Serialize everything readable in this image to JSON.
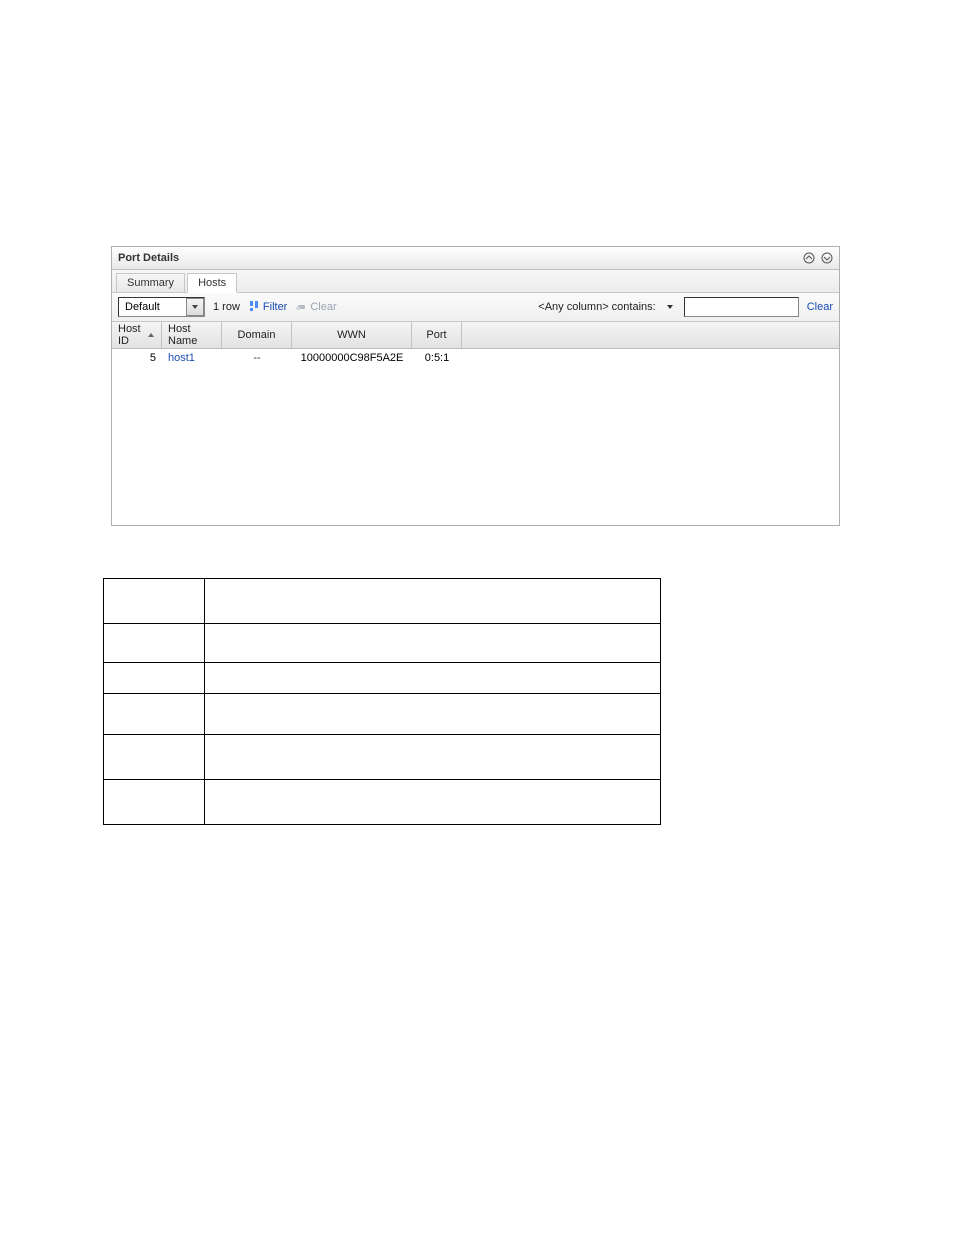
{
  "panel": {
    "title": "Port Details"
  },
  "tabs": {
    "summary": "Summary",
    "hosts": "Hosts",
    "active": "hosts"
  },
  "toolbar": {
    "view_selected": "Default",
    "row_count": "1 row",
    "filter_label": "Filter",
    "clear_filter_label": "Clear",
    "search_label": "<Any column> contains:",
    "search_value": "",
    "search_clear": "Clear"
  },
  "grid": {
    "columns": {
      "host_id": "Host ID",
      "host_name": "Host Name",
      "domain": "Domain",
      "wwn": "WWN",
      "port": "Port"
    },
    "sort": {
      "column": "host_id",
      "dir": "asc"
    },
    "rows": [
      {
        "host_id": "5",
        "host_name": "host1",
        "domain": "--",
        "wwn": "10000000C98F5A2E",
        "port": "0:5:1"
      }
    ]
  },
  "icons": {
    "collapse": "collapse",
    "help": "help",
    "sort_asc": "▲",
    "dropdown": "▼",
    "filter": "filter",
    "eraser": "eraser"
  },
  "lowtable_rows": [
    44,
    38,
    30,
    40,
    44,
    44
  ]
}
